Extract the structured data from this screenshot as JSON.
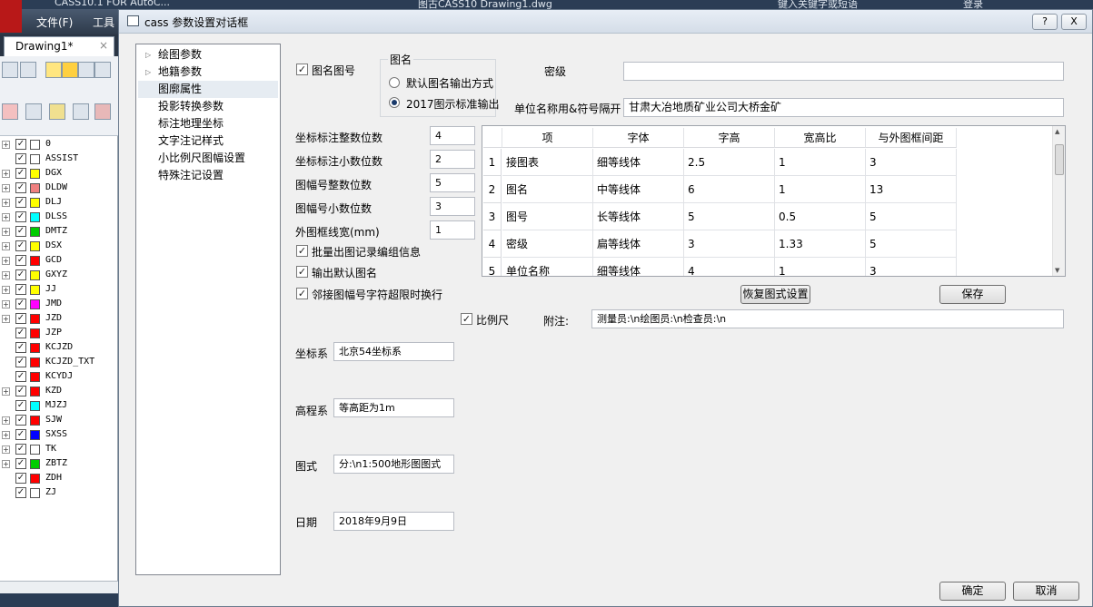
{
  "background": {
    "app_title": "CASS10.1 FOR AutoC...",
    "window_title": "图古CASS10    Drawing1.dwg",
    "search_placeholder": "键入关键字或短语",
    "login": "登录",
    "menu": [
      "文件(F)",
      "工具"
    ],
    "drawing_tab": "Drawing1*",
    "layers": [
      {
        "name": "0",
        "color": "#ffffff",
        "expand": true
      },
      {
        "name": "ASSIST",
        "color": "#ffffff",
        "expand": false
      },
      {
        "name": "DGX",
        "color": "#ffff00",
        "expand": true
      },
      {
        "name": "DLDW",
        "color": "#f08080",
        "expand": true
      },
      {
        "name": "DLJ",
        "color": "#ffff00",
        "expand": true
      },
      {
        "name": "DLSS",
        "color": "#00ffff",
        "expand": true
      },
      {
        "name": "DMTZ",
        "color": "#00cc00",
        "expand": true
      },
      {
        "name": "DSX",
        "color": "#ffff00",
        "expand": true
      },
      {
        "name": "GCD",
        "color": "#ff0000",
        "expand": true
      },
      {
        "name": "GXYZ",
        "color": "#ffff00",
        "expand": true
      },
      {
        "name": "JJ",
        "color": "#ffff00",
        "expand": true
      },
      {
        "name": "JMD",
        "color": "#ff00ff",
        "expand": true
      },
      {
        "name": "JZD",
        "color": "#ff0000",
        "expand": true
      },
      {
        "name": "JZP",
        "color": "#ff0000",
        "expand": false
      },
      {
        "name": "KCJZD",
        "color": "#ff0000",
        "expand": false
      },
      {
        "name": "KCJZD_TXT",
        "color": "#ff0000",
        "expand": false
      },
      {
        "name": "KCYDJ",
        "color": "#ff0000",
        "expand": false
      },
      {
        "name": "KZD",
        "color": "#ff0000",
        "expand": true
      },
      {
        "name": "MJZJ",
        "color": "#00ffff",
        "expand": false
      },
      {
        "name": "SJW",
        "color": "#ff0000",
        "expand": true
      },
      {
        "name": "SXSS",
        "color": "#0000ff",
        "expand": true
      },
      {
        "name": "TK",
        "color": "#ffffff",
        "expand": true
      },
      {
        "name": "ZBTZ",
        "color": "#00cc00",
        "expand": true
      },
      {
        "name": "ZDH",
        "color": "#ff0000",
        "expand": false
      },
      {
        "name": "ZJ",
        "color": "#ffffff",
        "expand": false
      }
    ]
  },
  "dialog": {
    "title": "cass 参数设置对话框",
    "help_label": "?",
    "close_label": "X",
    "nav": [
      {
        "label": "绘图参数",
        "expandable": true
      },
      {
        "label": "地籍参数",
        "expandable": true
      },
      {
        "label": "图廓属性",
        "expandable": false,
        "selected": true
      },
      {
        "label": "投影转换参数",
        "expandable": false
      },
      {
        "label": "标注地理坐标",
        "expandable": false
      },
      {
        "label": "文字注记样式",
        "expandable": false
      },
      {
        "label": "小比例尺图幅设置",
        "expandable": false
      },
      {
        "label": "特殊注记设置",
        "expandable": false
      }
    ],
    "map_name_checkbox": {
      "label": "图名图号",
      "checked": true
    },
    "map_name_group": {
      "title": "图名",
      "options": [
        {
          "label": "默认图名输出方式",
          "selected": false
        },
        {
          "label": "2017图示标准输出",
          "selected": true
        }
      ]
    },
    "secret_level": {
      "label": "密级",
      "value": ""
    },
    "unit_name": {
      "label": "单位名称用&符号隔开",
      "value": "甘肃大冶地质矿业公司大桥金矿"
    },
    "fields": [
      {
        "label": "坐标标注整数位数",
        "value": "4"
      },
      {
        "label": "坐标标注小数位数",
        "value": "2"
      },
      {
        "label": "图幅号整数位数",
        "value": "5"
      },
      {
        "label": "图幅号小数位数",
        "value": "3"
      },
      {
        "label": "外图框线宽(mm)",
        "value": "1"
      }
    ],
    "checkboxes": [
      {
        "label": "批量出图记录编组信息",
        "checked": true
      },
      {
        "label": "输出默认图名",
        "checked": true
      },
      {
        "label": "邻接图幅号字符超限时换行",
        "checked": true
      }
    ],
    "table": {
      "headers": [
        "项",
        "字体",
        "字高",
        "宽高比",
        "与外图框间距"
      ],
      "rows": [
        {
          "index": "1",
          "cells": [
            "接图表",
            "细等线体",
            "2.5",
            "1",
            "3"
          ]
        },
        {
          "index": "2",
          "cells": [
            "图名",
            "中等线体",
            "6",
            "1",
            "13"
          ]
        },
        {
          "index": "3",
          "cells": [
            "图号",
            "长等线体",
            "5",
            "0.5",
            "5"
          ]
        },
        {
          "index": "4",
          "cells": [
            "密级",
            "扁等线体",
            "3",
            "1.33",
            "5"
          ]
        },
        {
          "index": "5",
          "cells": [
            "单位名称",
            "细等线体",
            "4",
            "1",
            "3"
          ]
        }
      ]
    },
    "restore_button": "恢复图式设置",
    "save_button": "保存",
    "scale_checkbox": {
      "label": "比例尺",
      "checked": true
    },
    "note": {
      "label": "附注:",
      "value": "测量员:\\n绘图员:\\n检查员:\\n"
    },
    "coord_system": {
      "label": "坐标系",
      "value": "北京54坐标系"
    },
    "elevation_system": {
      "label": "高程系",
      "value": "等高距为1m"
    },
    "legend": {
      "label": "图式",
      "value": "分:\\n1:500地形图图式"
    },
    "date": {
      "label": "日期",
      "value": "2018年9月9日"
    },
    "ok_button": "确定",
    "cancel_button": "取消"
  }
}
